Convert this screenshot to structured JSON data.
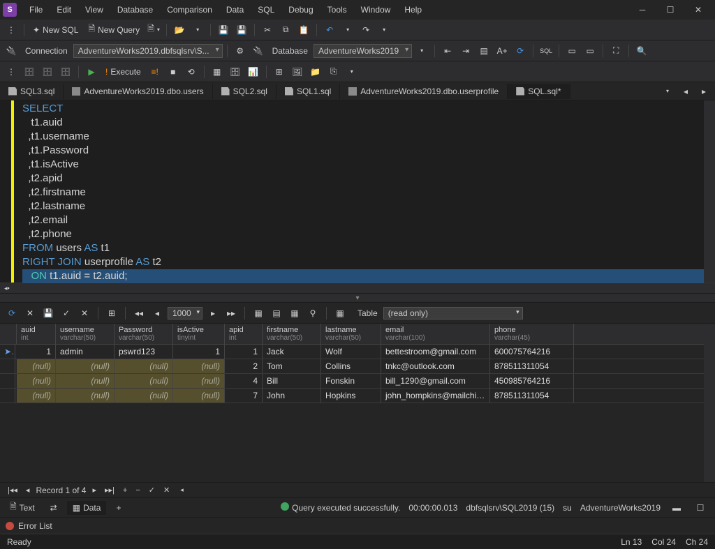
{
  "app": {
    "logo_letter": "S"
  },
  "menu": [
    "File",
    "Edit",
    "View",
    "Database",
    "Comparison",
    "Data",
    "SQL",
    "Debug",
    "Tools",
    "Window",
    "Help"
  ],
  "toolbar1": {
    "new_sql": "New SQL",
    "new_query": "New Query"
  },
  "toolbar2": {
    "connection_label": "Connection",
    "connection_value": "AdventureWorks2019.dbfsqlsrv\\S...",
    "database_label": "Database",
    "database_value": "AdventureWorks2019"
  },
  "toolbar3": {
    "execute": "Execute"
  },
  "tabs": [
    {
      "label": "SQL3.sql",
      "icon": "sql"
    },
    {
      "label": "AdventureWorks2019.dbo.users",
      "icon": "grid"
    },
    {
      "label": "SQL2.sql",
      "icon": "sql"
    },
    {
      "label": "SQL1.sql",
      "icon": "sql"
    },
    {
      "label": "AdventureWorks2019.dbo.userprofile",
      "icon": "grid"
    },
    {
      "label": "SQL.sql*",
      "icon": "sql",
      "active": true
    }
  ],
  "sql": {
    "lines": [
      {
        "tokens": [
          [
            "kw",
            "SELECT"
          ]
        ]
      },
      {
        "tokens": [
          [
            "id",
            "   t1.auid"
          ]
        ]
      },
      {
        "tokens": [
          [
            "id",
            "  ,t1.username"
          ]
        ]
      },
      {
        "tokens": [
          [
            "id",
            "  ,t1.Password"
          ]
        ]
      },
      {
        "tokens": [
          [
            "id",
            "  ,t1.isActive"
          ]
        ]
      },
      {
        "tokens": [
          [
            "id",
            "  ,t2.apid"
          ]
        ]
      },
      {
        "tokens": [
          [
            "id",
            "  ,t2.firstname"
          ]
        ]
      },
      {
        "tokens": [
          [
            "id",
            "  ,t2.lastname"
          ]
        ]
      },
      {
        "tokens": [
          [
            "id",
            "  ,t2.email"
          ]
        ]
      },
      {
        "tokens": [
          [
            "id",
            "  ,t2.phone"
          ]
        ]
      },
      {
        "tokens": [
          [
            "kw",
            "FROM"
          ],
          [
            "id",
            " users "
          ],
          [
            "kw",
            "AS"
          ],
          [
            "id",
            " t1"
          ]
        ]
      },
      {
        "tokens": [
          [
            "kw",
            "RIGHT JOIN"
          ],
          [
            "id",
            " userprofile "
          ],
          [
            "kw",
            "AS"
          ],
          [
            "id",
            " t2"
          ]
        ]
      },
      {
        "tokens": [
          [
            "kw2",
            "   ON"
          ],
          [
            "id",
            " t1.auid = t2.auid;"
          ]
        ],
        "highlight": true
      }
    ]
  },
  "results_toolbar": {
    "page_size": "1000",
    "table_label": "Table",
    "readonly": "(read only)"
  },
  "grid": {
    "columns": [
      {
        "name": "auid",
        "type": "int"
      },
      {
        "name": "username",
        "type": "varchar(50)"
      },
      {
        "name": "Password",
        "type": "varchar(50)"
      },
      {
        "name": "isActive",
        "type": "tinyint"
      },
      {
        "name": "apid",
        "type": "int"
      },
      {
        "name": "firstname",
        "type": "varchar(50)"
      },
      {
        "name": "lastname",
        "type": "varchar(50)"
      },
      {
        "name": "email",
        "type": "varchar(100)"
      },
      {
        "name": "phone",
        "type": "varchar(45)"
      }
    ],
    "rows": [
      {
        "sel": "➤",
        "c": [
          "1",
          "admin",
          "pswrd123",
          "1",
          "1",
          "Jack",
          "Wolf",
          "bettestroom@gmail.com",
          "600075764216"
        ]
      },
      {
        "sel": "",
        "nulls": [
          0,
          1,
          2,
          3
        ],
        "c": [
          "(null)",
          "(null)",
          "(null)",
          "(null)",
          "2",
          "Tom",
          "Collins",
          "tnkc@outlook.com",
          "878511311054"
        ]
      },
      {
        "sel": "",
        "nulls": [
          0,
          1,
          2,
          3
        ],
        "c": [
          "(null)",
          "(null)",
          "(null)",
          "(null)",
          "4",
          "Bill",
          "Fonskin",
          "bill_1290@gmail.com",
          "450985764216"
        ]
      },
      {
        "sel": "",
        "nulls": [
          0,
          1,
          2,
          3
        ],
        "c": [
          "(null)",
          "(null)",
          "(null)",
          "(null)",
          "7",
          "John",
          "Hopkins",
          "john_hompkins@mailchimp.com",
          "878511311054"
        ]
      }
    ]
  },
  "recordnav": {
    "text": "Record 1 of 4"
  },
  "resultstabs": {
    "text": "Text",
    "data": "Data"
  },
  "status": {
    "msg": "Query executed successfully.",
    "time": "00:00:00.013",
    "server": "dbfsqlsrv\\SQL2019 (15)",
    "user": "su",
    "db": "AdventureWorks2019"
  },
  "error_list": {
    "label": "Error List"
  },
  "footer": {
    "ready": "Ready",
    "ln": "Ln 13",
    "col": "Col 24",
    "ch": "Ch 24"
  }
}
